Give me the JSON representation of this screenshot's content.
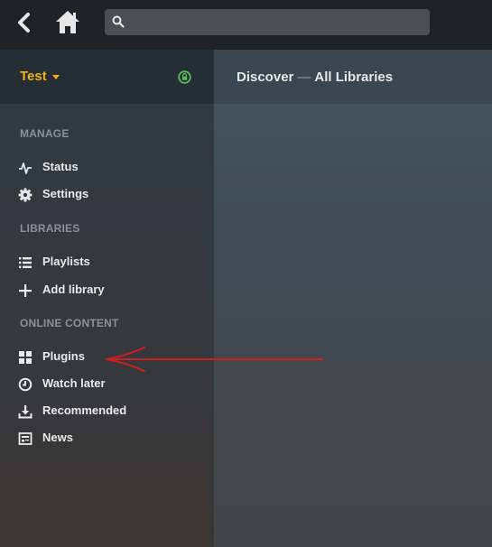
{
  "search": {
    "placeholder": "",
    "value": ""
  },
  "sidebar": {
    "server_name": "Test",
    "sections": {
      "manage": "MANAGE",
      "libraries": "LIBRARIES",
      "online": "ONLINE CONTENT"
    },
    "items": {
      "status": "Status",
      "settings": "Settings",
      "playlists": "Playlists",
      "add_library": "Add library",
      "plugins": "Plugins",
      "watch_later": "Watch later",
      "recommended": "Recommended",
      "news": "News"
    }
  },
  "main": {
    "title_part1": "Discover",
    "title_sep": "—",
    "title_part2": "All Libraries"
  },
  "colors": {
    "accent": "#f0ad16",
    "lock_green": "#5cb85c",
    "annotation_arrow": "#cc1f1f",
    "topbar": "#1f2326"
  }
}
